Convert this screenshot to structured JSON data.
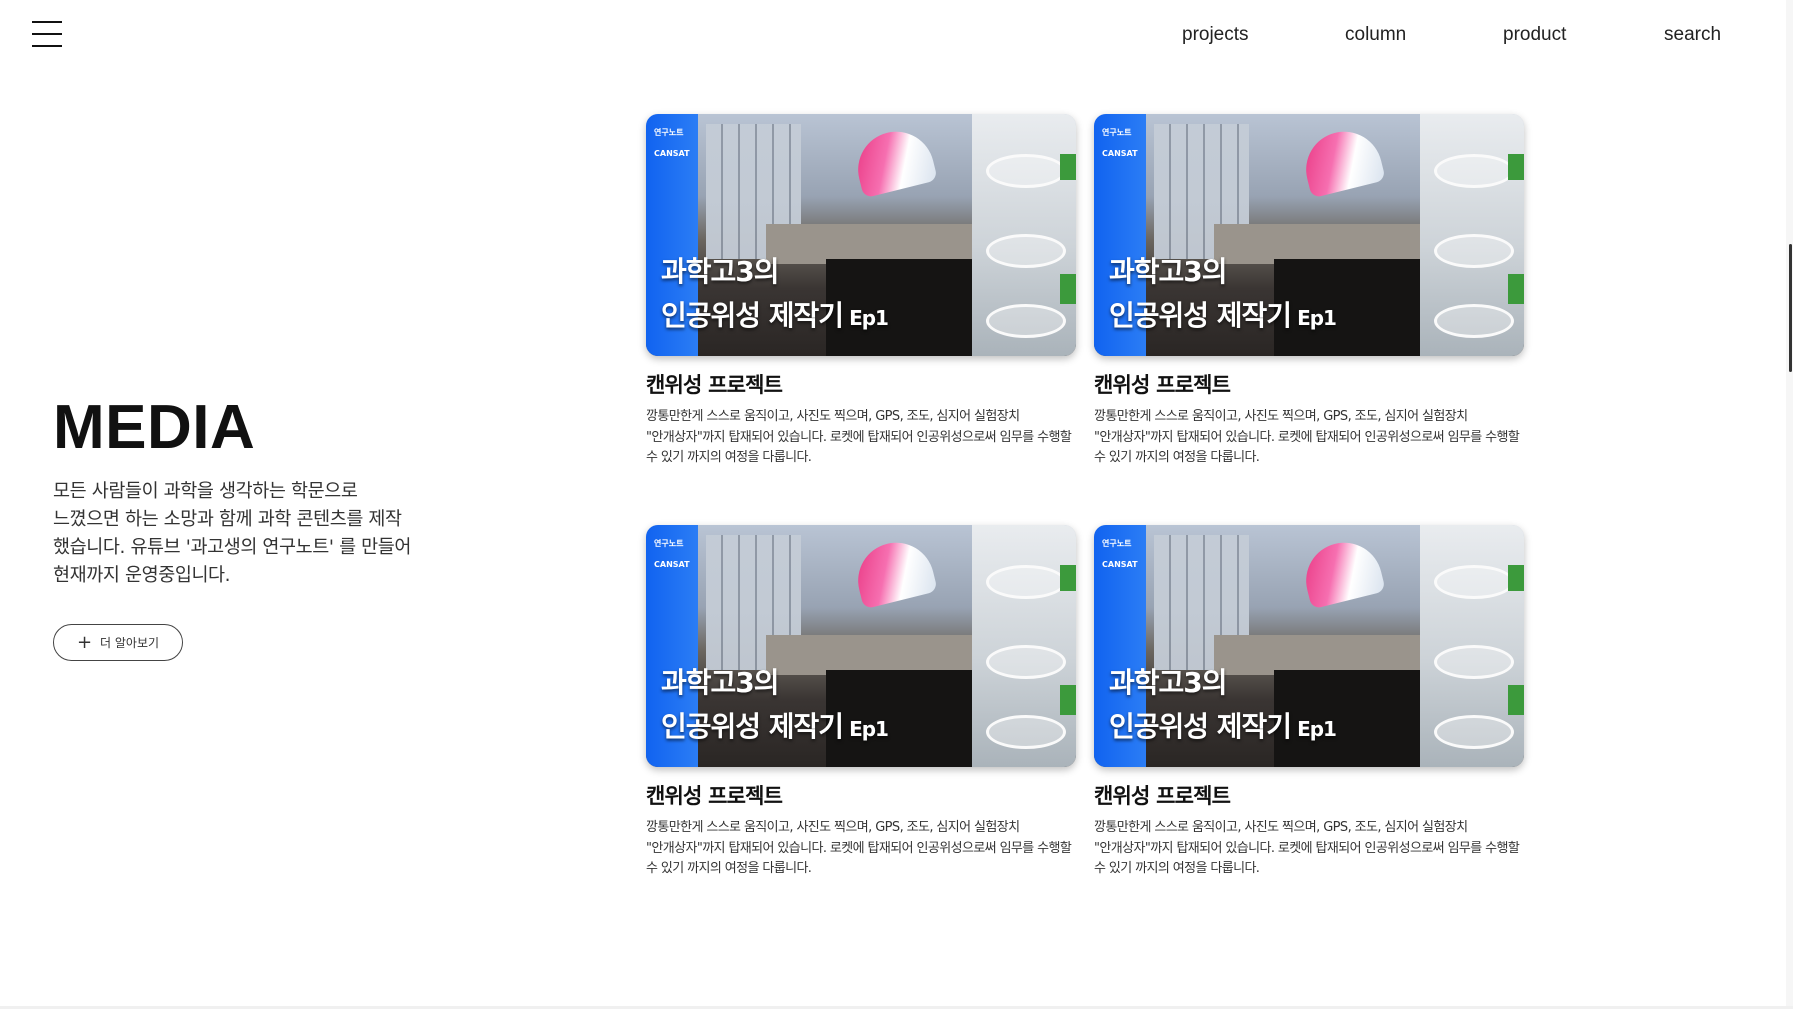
{
  "header": {
    "menu_icon": "hamburger-menu-icon",
    "nav": [
      {
        "label": "projects"
      },
      {
        "label": "column"
      },
      {
        "label": "product"
      },
      {
        "label": "search"
      }
    ]
  },
  "intro": {
    "title": "MEDIA",
    "description": "모든 사람들이 과학을 생각하는 학문으로 느꼈으면 하는 소망과 함께 과학 콘텐츠를 제작 했습니다. 유튜브 '과고생의 연구노트' 를 만들어 현재까지 운영중입니다.",
    "more_button": {
      "icon": "plus-icon",
      "label": "더 알아보기"
    }
  },
  "cards": [
    {
      "thumb_tag1": "연구노트",
      "thumb_tag2": "CANSAT",
      "thumb_line1": "과학고3의",
      "thumb_line2": "인공위성 제작기",
      "thumb_ep": "Ep1",
      "title": "캔위성 프로젝트",
      "description": "깡통만한게 스스로 움직이고, 사진도 찍으며, GPS, 조도, 심지어 실험장치 \"안개상자\"까지 탑재되어 있습니다. 로켓에 탑재되어 인공위성으로써 임무를 수행할 수 있기 까지의 여정을 다룹니다."
    },
    {
      "thumb_tag1": "연구노트",
      "thumb_tag2": "CANSAT",
      "thumb_line1": "과학고3의",
      "thumb_line2": "인공위성 제작기",
      "thumb_ep": "Ep1",
      "title": "캔위성 프로젝트",
      "description": "깡통만한게 스스로 움직이고, 사진도 찍으며, GPS, 조도, 심지어 실험장치 \"안개상자\"까지 탑재되어 있습니다. 로켓에 탑재되어 인공위성으로써 임무를 수행할 수 있기 까지의 여정을 다룹니다."
    },
    {
      "thumb_tag1": "연구노트",
      "thumb_tag2": "CANSAT",
      "thumb_line1": "과학고3의",
      "thumb_line2": "인공위성 제작기",
      "thumb_ep": "Ep1",
      "title": "캔위성 프로젝트",
      "description": "깡통만한게 스스로 움직이고, 사진도 찍으며, GPS, 조도, 심지어 실험장치 \"안개상자\"까지 탑재되어 있습니다. 로켓에 탑재되어 인공위성으로써 임무를 수행할 수 있기 까지의 여정을 다룹니다."
    },
    {
      "thumb_tag1": "연구노트",
      "thumb_tag2": "CANSAT",
      "thumb_line1": "과학고3의",
      "thumb_line2": "인공위성 제작기",
      "thumb_ep": "Ep1",
      "title": "캔위성 프로젝트",
      "description": "깡통만한게 스스로 움직이고, 사진도 찍으며, GPS, 조도, 심지어 실험장치 \"안개상자\"까지 탑재되어 있습니다. 로켓에 탑재되어 인공위성으로써 임무를 수행할 수 있기 까지의 여정을 다룹니다."
    }
  ]
}
